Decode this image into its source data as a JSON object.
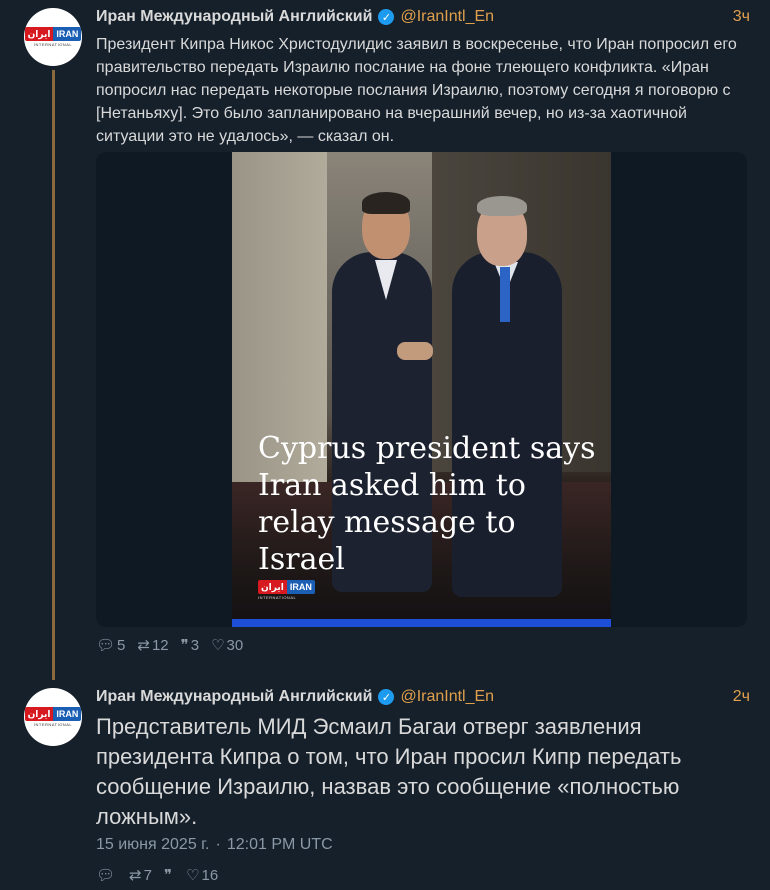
{
  "tweets": [
    {
      "author_name": "Иран Международный Английский",
      "handle": "@IranIntl_En",
      "time": "3ч",
      "text": "Президент Кипра Никос Христодулидис заявил в воскресенье, что Иран попросил его правительство передать Израилю послание на фоне тлеющего конфликта. «Иран попросил нас передать некоторые послания Израилю, поэтому сегодня я поговорю с [Нетаньяху]. Это было запланировано на вчерашний вечер, но из-за хаотичной ситуации это не удалось», — сказал он.",
      "media": {
        "headline": "Cyprus president says Iran asked him to relay message to Israel",
        "logo_fa": "ایران",
        "logo_en": "IRAN",
        "logo_sub": "INTERNATIONAL"
      },
      "actions": {
        "replies": "5",
        "retweets": "12",
        "quotes": "3",
        "likes": "30"
      }
    },
    {
      "author_name": "Иран Международный Английский",
      "handle": "@IranIntl_En",
      "time": "2ч",
      "text": "Представитель МИД Эсмаил Багаи отверг заявления президента Кипра о том, что Иран просил Кипр передать сообщение Израилю, назвав это сообщение «полностью ложным».",
      "date": "15 июня 2025 г.",
      "date_sep": "·",
      "clock": "12:01 PM UTC",
      "actions": {
        "replies": "",
        "retweets": "7",
        "quotes": "",
        "likes": "16"
      }
    }
  ],
  "avatar_logo": {
    "fa": "ایران",
    "en": "IRAN",
    "sub": "INTERNATIONAL"
  },
  "icons": {
    "reply": "speech-bubble-icon",
    "retweet": "retweet-icon",
    "quote": "quote-icon",
    "like": "heart-icon",
    "verified": "verified-badge-icon"
  },
  "colors": {
    "background": "#15202b",
    "accent": "#e0a04c",
    "verified": "#1d9bf0",
    "thread_line": "#8a6a3c"
  }
}
